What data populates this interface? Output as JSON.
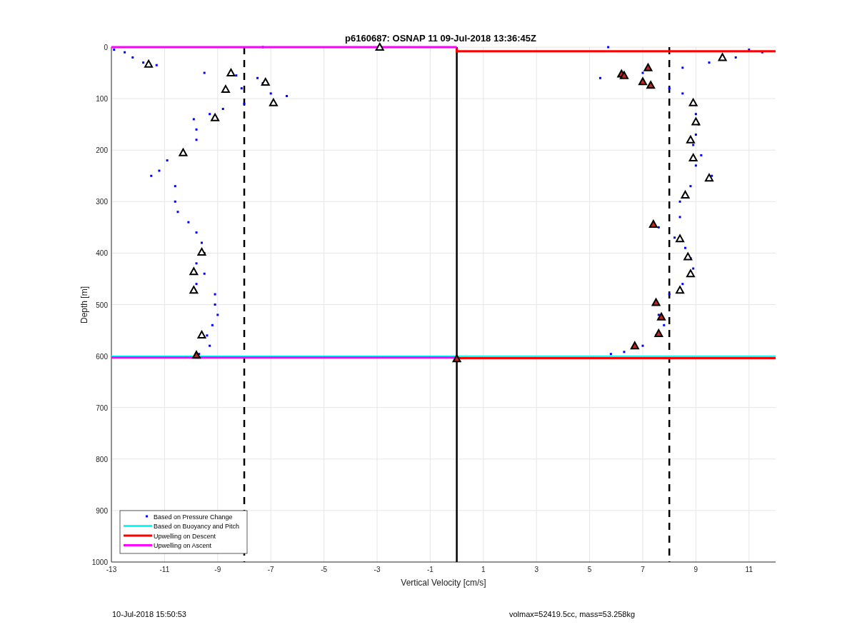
{
  "figure": {
    "title": "p6160687: OSNAP 11 09-Jul-2018 13:36:45Z",
    "footer_left": "10-Jul-2018 15:50:53",
    "footer_right": "volmax=52419.5cc, mass=53.258kg",
    "chart_data": {
      "type": "scatter",
      "xlabel": "Vertical Velocity [cm/s]",
      "ylabel": "Depth [m]",
      "xlim": [
        -13,
        12
      ],
      "ylim": [
        1000,
        0
      ],
      "xticks": [
        -13,
        -11,
        -9,
        -7,
        -5,
        -3,
        -1,
        1,
        3,
        5,
        7,
        9,
        11
      ],
      "yticks": [
        0,
        100,
        200,
        300,
        400,
        500,
        600,
        700,
        800,
        900,
        1000
      ],
      "grid": true,
      "legend": true,
      "ref_lines": [
        {
          "axis": "x",
          "value": 0,
          "color": "#000000"
        },
        {
          "axis": "x",
          "value": -8,
          "color": "#000000"
        },
        {
          "axis": "x",
          "value": 8,
          "color": "#000000"
        }
      ],
      "series": [
        {
          "name": "Based on Pressure Change",
          "type": "scatter",
          "marker": "square",
          "color": "#0000ff",
          "x": [
            -12.9,
            -12.5,
            -12.2,
            -11.8,
            -11.3,
            -9.5,
            -8.3,
            -7.5,
            -7.3,
            -8.1,
            -7.0,
            -6.4,
            -8.0,
            -8.8,
            -9.3,
            -9.9,
            -9.8,
            -9.8,
            -10.3,
            -10.9,
            -11.2,
            -11.5,
            -10.6,
            -10.6,
            -10.5,
            -10.1,
            -9.8,
            -9.6,
            -9.5,
            -9.8,
            -9.5,
            -9.8,
            -9.1,
            -9.1,
            -9.0,
            -9.2,
            -9.4,
            -9.3,
            -9.7,
            11.5,
            10.5,
            9.5,
            8.5,
            7.0,
            5.4,
            8.0,
            8.5,
            9.0,
            9.1,
            9.0,
            8.9,
            9.2,
            9.0,
            9.6,
            8.8,
            8.4,
            8.4,
            7.6,
            8.2,
            8.6,
            8.8,
            8.9,
            8.5,
            8.0,
            7.6,
            7.8,
            7.5,
            7.0,
            6.3,
            5.8,
            -7.3,
            5.7,
            11
          ],
          "values": [
            5,
            10,
            20,
            30,
            35,
            50,
            55,
            60,
            70,
            80,
            90,
            95,
            110,
            120,
            130,
            140,
            160,
            180,
            200,
            220,
            240,
            250,
            270,
            300,
            320,
            340,
            360,
            380,
            400,
            420,
            440,
            460,
            480,
            500,
            520,
            540,
            560,
            580,
            596,
            10,
            20,
            30,
            40,
            50,
            60,
            80,
            90,
            130,
            150,
            170,
            190,
            210,
            230,
            250,
            270,
            300,
            330,
            350,
            370,
            390,
            410,
            430,
            460,
            480,
            520,
            540,
            560,
            580,
            592,
            596,
            0,
            0,
            5
          ]
        },
        {
          "name": "Based on Buoyancy and Pitch",
          "type": "line",
          "color": "#00ffff",
          "x": [
            -13,
            12
          ],
          "values": [
            601,
            601
          ]
        },
        {
          "name": "Upwelling on Descent",
          "type": "line",
          "color": "#ff0000",
          "x": [
            0,
            0,
            12
          ],
          "values": [
            2,
            8,
            8
          ]
        },
        {
          "name": "Upwelling on Ascent",
          "type": "line",
          "color": "#ff00ff",
          "x": [
            -13,
            0
          ],
          "values": [
            0,
            0
          ]
        },
        {
          "type": "line",
          "color": "#ff0000",
          "x": [
            0,
            12
          ],
          "values": [
            604,
            604
          ]
        },
        {
          "type": "line",
          "color": "#ff00ff",
          "x": [
            -13,
            0
          ],
          "values": [
            603,
            603
          ]
        },
        {
          "type": "scatter",
          "marker": "triangle",
          "color": "#ffffff",
          "x": [
            -11.6,
            -8.5,
            -7.2,
            -8.7,
            -6.9,
            -9.1,
            -10.3,
            -9.6,
            -9.9,
            -9.9,
            -9.6,
            -2.9,
            10,
            8.9,
            9.0,
            8.8,
            8.9,
            9.5,
            8.6,
            8.4,
            8.7,
            8.8,
            8.4
          ],
          "values": [
            33,
            50,
            68,
            82,
            108,
            137,
            205,
            398,
            436,
            472,
            559,
            0,
            20,
            108,
            145,
            180,
            215,
            254,
            287,
            372,
            407,
            440,
            472
          ]
        },
        {
          "type": "scatter",
          "marker": "triangle",
          "color": "#c0281e",
          "x": [
            7.2,
            6.2,
            6.3,
            7.0,
            7.3,
            7.4,
            7.5,
            7.7,
            7.6,
            6.7,
            -9.8,
            0
          ],
          "values": [
            40,
            52,
            55,
            67,
            74,
            344,
            496,
            524,
            556,
            580,
            598,
            605
          ]
        }
      ]
    }
  }
}
